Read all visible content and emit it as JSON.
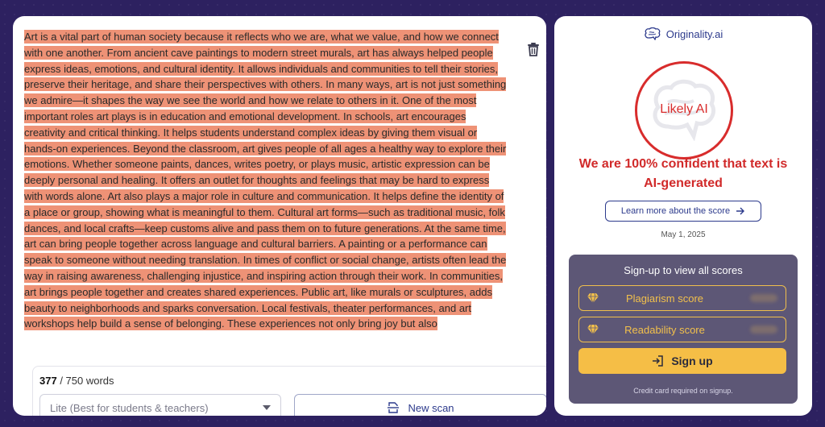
{
  "editor": {
    "text": "Art is a vital part of human society because it reflects who we are, what we value, and how we connect with one another. From ancient cave paintings to modern street murals, art has always helped people express ideas, emotions, and cultural identity. It allows individuals and communities to tell their stories, preserve their heritage, and share their perspectives with others. In many ways, art is not just something we admire—it shapes the way we see the world and how we relate to others in it. One of the most important roles art plays is in education and emotional development. In schools, art encourages creativity and critical thinking. It helps students understand complex ideas by giving them visual or hands-on experiences. Beyond the classroom, art gives people of all ages a healthy way to explore their emotions. Whether someone paints, dances, writes poetry, or plays music, artistic expression can be deeply personal and healing. It offers an outlet for thoughts and feelings that may be hard to express with words alone. Art also plays a major role in culture and communication. It helps define the identity of a place or group, showing what is meaningful to them. Cultural art forms—such as traditional music, folk dances, and local crafts—keep customs alive and pass them on to future generations. At the same time, art can bring people together across language and cultural barriers. A painting or a performance can speak to someone without needing translation. In times of conflict or social change, artists often lead the way in raising awareness, challenging injustice, and inspiring action through their work. In communities, art brings people together and creates shared experiences. Public art, like murals or sculptures, adds beauty to neighborhoods and sparks conversation. Local festivals, theater performances, and art workshops help build a sense of belonging. These experiences not only bring joy but also",
    "highlight_color": "#ee9276"
  },
  "word_count": {
    "current": "377",
    "limit": " / 750 words"
  },
  "controls": {
    "mode_selected": "Lite (Best for students & teachers)",
    "scan_label": "New scan"
  },
  "brand": {
    "name": "Originality.ai"
  },
  "result": {
    "verdict": "Likely AI",
    "confidence_message": "We are 100% confident that text is AI-generated",
    "learn_more_label": "Learn more about the score",
    "date": "May 1, 2025",
    "accent_color": "#d82c2c"
  },
  "signup": {
    "title": "Sign-up to view all scores",
    "plagiarism_label": "Plagiarism score",
    "readability_label": "Readability score",
    "button_label": "Sign up",
    "note": "Credit card required on signup."
  },
  "icons": [
    "trash-icon",
    "chevron-down-icon",
    "scan-document-icon",
    "brain-logo-icon",
    "arrow-right-icon",
    "diamond-icon",
    "login-icon"
  ]
}
